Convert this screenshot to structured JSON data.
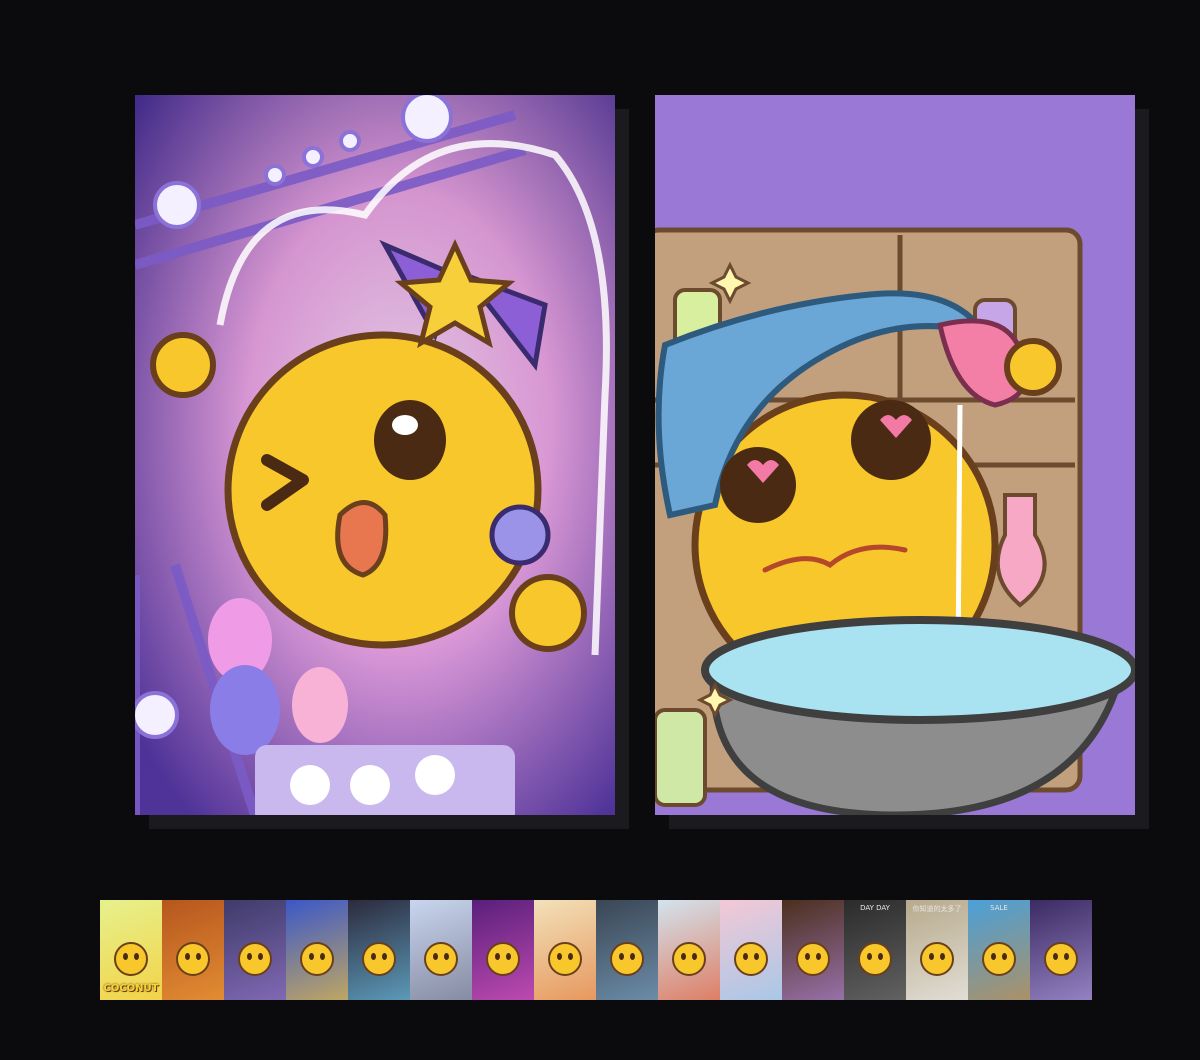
{
  "viewer": {
    "left_page": {
      "scene": "idol-stage",
      "colors": {
        "bg_top": "#2b2470",
        "bg_glow": "#f6b6e6",
        "accent": "#8d5fd6"
      }
    },
    "right_page": {
      "scene": "potion-cauldron",
      "colors": {
        "bg": "#9a79d6",
        "shelf": "#c2a07e",
        "cauldron": "#8d8d8d",
        "liquid": "#a9e3f1"
      }
    }
  },
  "thumbnails": [
    {
      "id": "t1",
      "bg": "#e6f18d",
      "accent": "#f8c72c",
      "label": "COCONUT",
      "note": ""
    },
    {
      "id": "t2",
      "bg": "#b6561e",
      "accent": "#f3a23b",
      "label": "",
      "note": ""
    },
    {
      "id": "t3",
      "bg": "#3e3b6a",
      "accent": "#9b7bd1",
      "label": "",
      "note": ""
    },
    {
      "id": "t4",
      "bg": "#3b57c9",
      "accent": "#f2c63a",
      "label": "",
      "note": ""
    },
    {
      "id": "t5",
      "bg": "#2c2a3d",
      "accent": "#6ec6e9",
      "label": "",
      "note": ""
    },
    {
      "id": "t6",
      "bg": "#c9d5ee",
      "accent": "#6a6e85",
      "label": "",
      "note": ""
    },
    {
      "id": "t7",
      "bg": "#5a1f7b",
      "accent": "#e45bc6",
      "label": "",
      "note": ""
    },
    {
      "id": "t8",
      "bg": "#f2e1b9",
      "accent": "#e27b3a",
      "label": "",
      "note": ""
    },
    {
      "id": "t9",
      "bg": "#3a4654",
      "accent": "#7fa8c9",
      "label": "",
      "note": ""
    },
    {
      "id": "t10",
      "bg": "#d3e3ee",
      "accent": "#e2562e",
      "label": "",
      "note": ""
    },
    {
      "id": "t11",
      "bg": "#f3c8d6",
      "accent": "#8cc6ee",
      "label": "",
      "note": ""
    },
    {
      "id": "t12",
      "bg": "#4b2f1e",
      "accent": "#b58be0",
      "label": "",
      "note": ""
    },
    {
      "id": "t13",
      "bg": "#2b2b2b",
      "accent": "#777777",
      "label": "",
      "note": "DAY DAY"
    },
    {
      "id": "t14",
      "bg": "#b7aa8c",
      "accent": "#f2f2f2",
      "label": "",
      "note": "你知道的太多了"
    },
    {
      "id": "t15",
      "bg": "#4aa0d9",
      "accent": "#d18b3a",
      "label": "",
      "note": "SALE"
    },
    {
      "id": "t16",
      "bg": "#3c2a63",
      "accent": "#b7a4e8",
      "label": "",
      "note": ""
    }
  ]
}
